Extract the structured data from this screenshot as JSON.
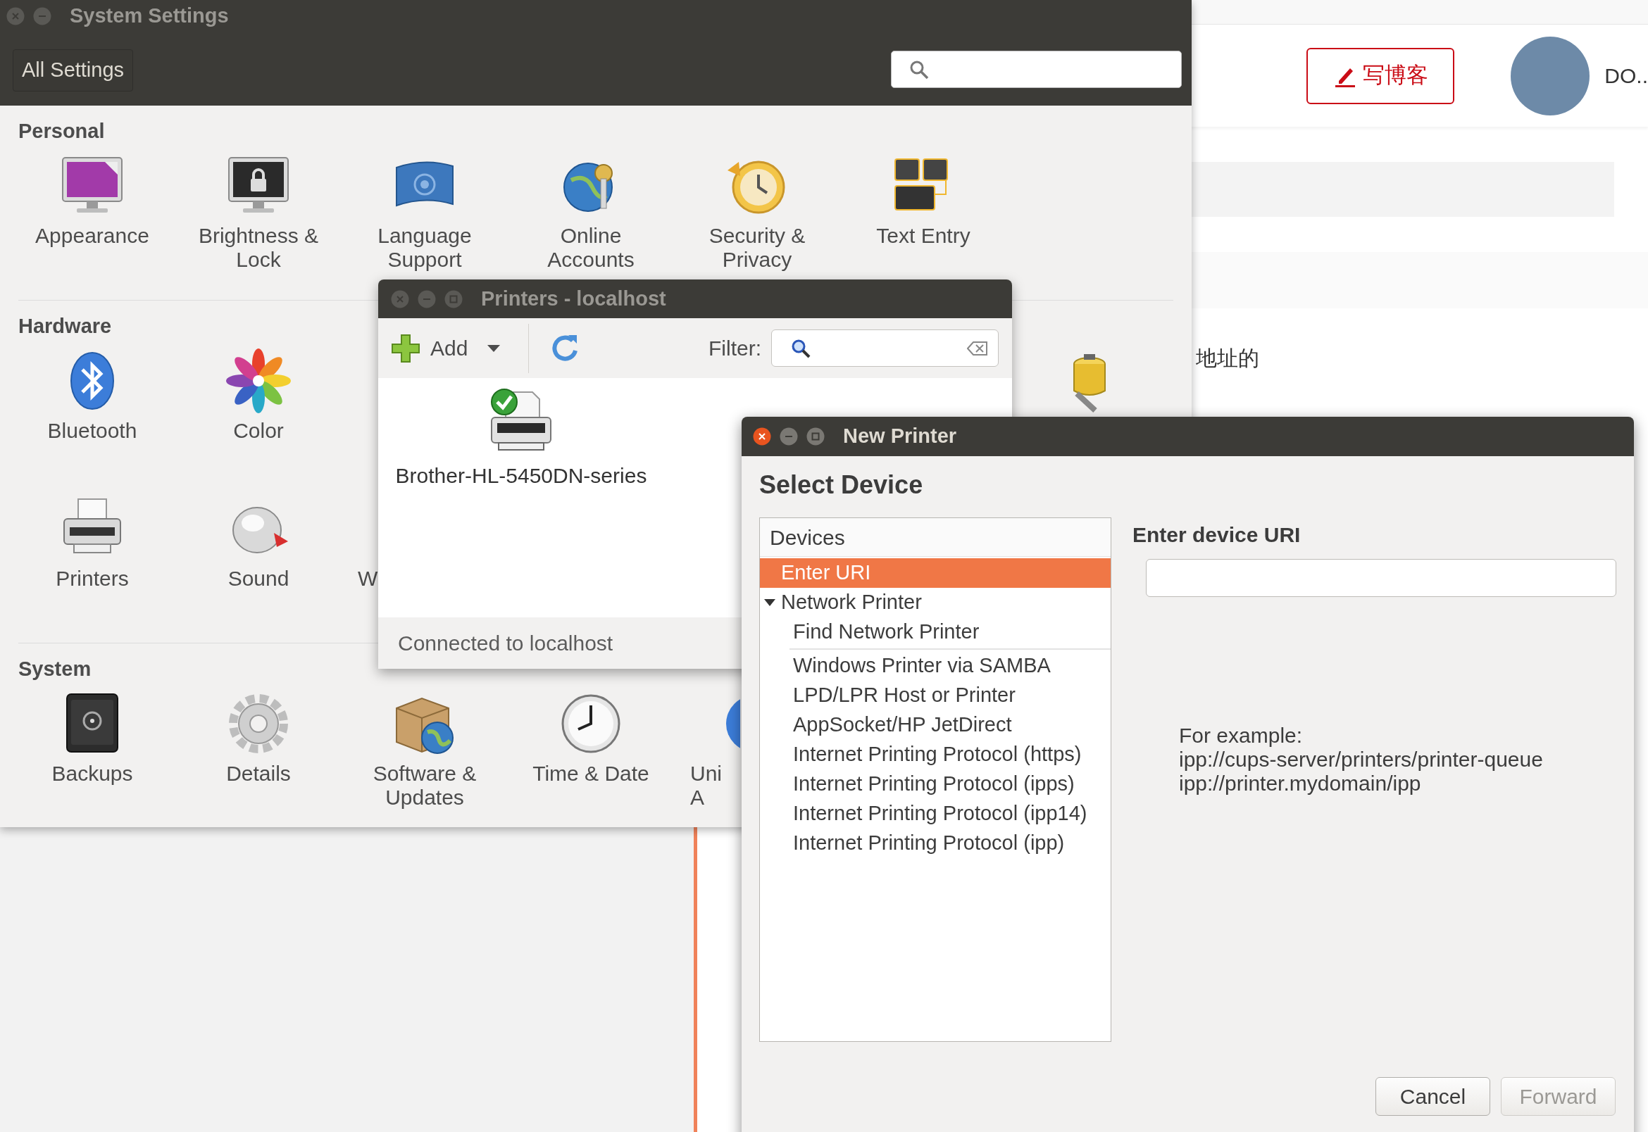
{
  "blog_page": {
    "write_button": "写博客",
    "user_name": "DO..",
    "snippet": "地址的"
  },
  "settings_window": {
    "title": "System Settings",
    "all_settings_button": "All Settings",
    "sections": [
      {
        "title": "Personal",
        "items": [
          {
            "kind": "full",
            "label": "Appearance"
          },
          {
            "kind": "full",
            "label": "Brightness & Lock"
          },
          {
            "kind": "full",
            "label": "Language Support"
          },
          {
            "kind": "full",
            "label": "Online Accounts"
          },
          {
            "kind": "full",
            "label": "Security & Privacy"
          },
          {
            "kind": "full",
            "label": "Text Entry"
          }
        ]
      },
      {
        "title": "Hardware",
        "items": [
          {
            "kind": "full",
            "label": "Bluetooth"
          },
          {
            "kind": "full",
            "label": "Color"
          },
          {
            "kind": "icon_only"
          },
          {
            "kind": "full",
            "label": "Printers"
          },
          {
            "kind": "full",
            "label": "Sound"
          },
          {
            "kind": "partial",
            "lines": [
              "W"
            ]
          }
        ]
      },
      {
        "title": "System",
        "items": [
          {
            "kind": "full",
            "label": "Backups"
          },
          {
            "kind": "full",
            "label": "Details"
          },
          {
            "kind": "full",
            "label": "Software & Updates"
          },
          {
            "kind": "full",
            "label": "Time & Date"
          },
          {
            "kind": "partial",
            "lines": [
              "Uni",
              "A"
            ]
          }
        ]
      }
    ]
  },
  "printers_window": {
    "title": "Printers - localhost",
    "add_button": "Add",
    "filter_label": "Filter:",
    "printers": [
      {
        "name": "Brother-HL-5450DN-series"
      }
    ],
    "status": "Connected to localhost"
  },
  "new_printer_dialog": {
    "title": "New Printer",
    "heading": "Select Device",
    "devices_header": "Devices",
    "devices": [
      {
        "label": "Enter URI",
        "selected": true
      },
      {
        "label": "Network Printer",
        "selected": false,
        "expanded": true,
        "children": [
          {
            "label": "Find Network Printer",
            "selected": false
          },
          {
            "label": "Windows Printer via SAMBA",
            "selected": false,
            "separator_above": true
          },
          {
            "label": "LPD/LPR Host or Printer",
            "selected": false
          },
          {
            "label": "AppSocket/HP JetDirect",
            "selected": false
          },
          {
            "label": "Internet Printing Protocol (https)",
            "selected": false
          },
          {
            "label": "Internet Printing Protocol (ipps)",
            "selected": false
          },
          {
            "label": "Internet Printing Protocol (ipp14)",
            "selected": false
          },
          {
            "label": "Internet Printing Protocol (ipp)",
            "selected": false
          }
        ]
      }
    ],
    "uri_label": "Enter device URI",
    "example_lines": [
      "For example:",
      "ipp://cups-server/printers/printer-queue",
      "ipp://printer.mydomain/ipp"
    ],
    "buttons": [
      {
        "label": "Cancel",
        "disabled": false
      },
      {
        "label": "Forward",
        "disabled": true
      }
    ]
  }
}
